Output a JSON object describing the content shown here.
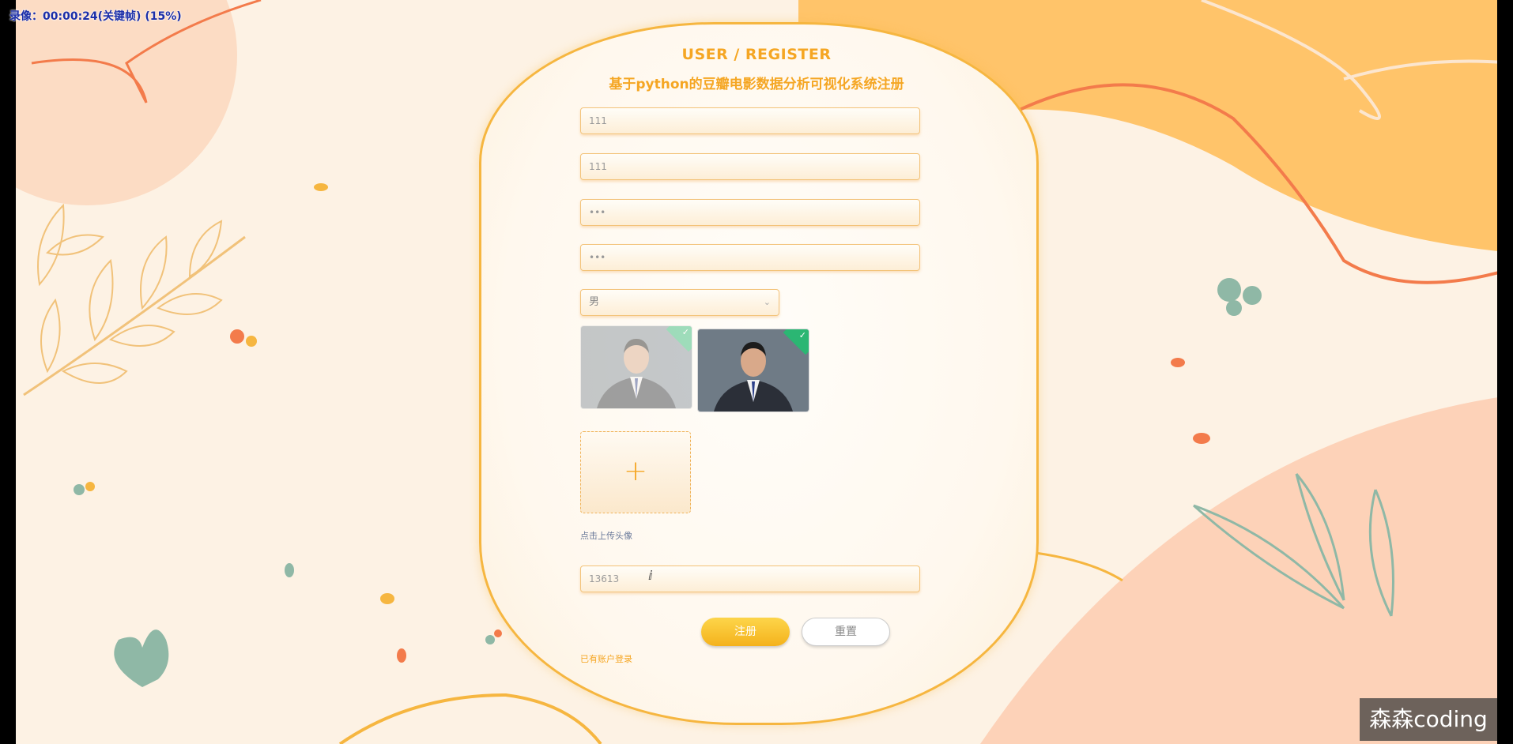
{
  "recording": {
    "label": "录像：00:00:24(关键帧) (15%)"
  },
  "header": {
    "title_en": "USER / REGISTER",
    "title_cn": "基于python的豆瓣电影数据分析可视化系统注册"
  },
  "form": {
    "account": {
      "value": "111"
    },
    "name": {
      "value": "111"
    },
    "password": {
      "value": "•••"
    },
    "confirm_password": {
      "value": "•••"
    },
    "gender": {
      "selected": "男"
    },
    "upload": {
      "hint": "点击上传头像"
    },
    "phone": {
      "value": "13613"
    }
  },
  "actions": {
    "register_label": "注册",
    "reset_label": "重置",
    "login_link": "已有账户登录"
  },
  "watermark": {
    "text": "森森coding"
  },
  "colors": {
    "accent": "#f5a623",
    "card_border": "#f6b640",
    "success": "#2bb673"
  }
}
